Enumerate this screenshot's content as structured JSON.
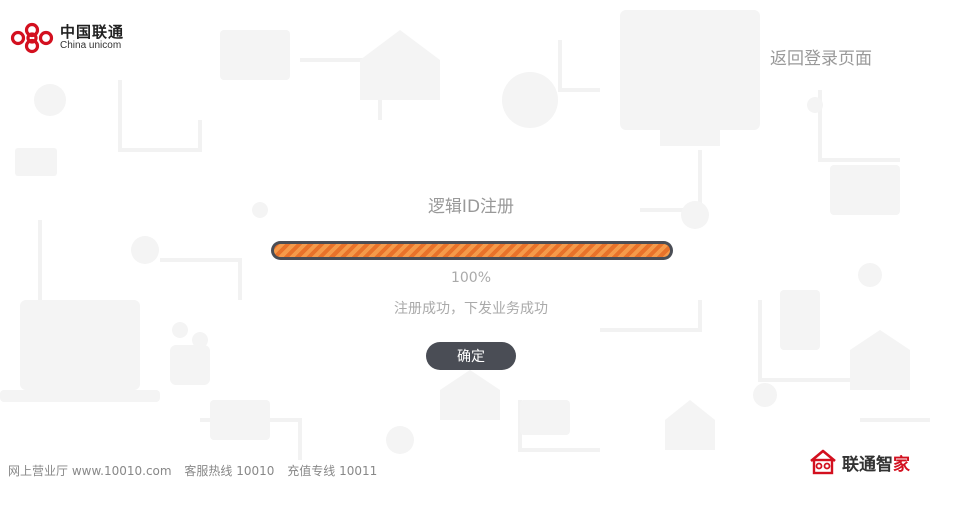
{
  "header": {
    "logo_cn": "中国联通",
    "logo_en": "China unicom",
    "back_link": "返回登录页面"
  },
  "main": {
    "title": "逻辑ID注册",
    "progress_percent": 100,
    "progress_text": "100%",
    "status_text": "注册成功，下发业务成功",
    "confirm_label": "确定"
  },
  "footer": {
    "website": "网上营业厅 www.10010.com",
    "hotline": "客服热线 10010",
    "recharge": "充值专线 10011"
  },
  "brand": {
    "name_part1": "联通智",
    "name_part2": "家"
  },
  "colors": {
    "accent": "#e8722a",
    "dark": "#4a4d55",
    "brand_red": "#d3101f"
  },
  "icons": [
    "china-unicom-logo-icon",
    "house-brand-icon"
  ]
}
